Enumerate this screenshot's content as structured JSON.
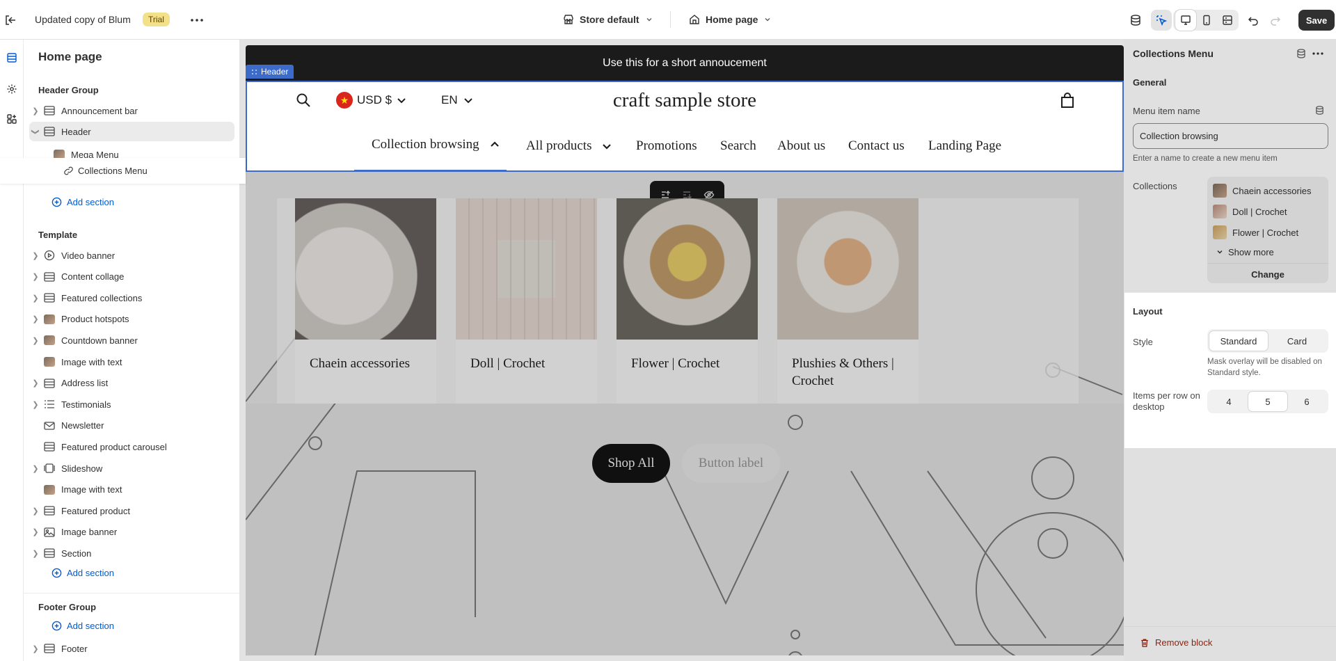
{
  "topbar": {
    "store_name": "Updated copy of Blum",
    "trial_badge": "Trial",
    "theme_select": "Store default",
    "page_select": "Home page",
    "save_label": "Save"
  },
  "left_panel": {
    "title": "Home page",
    "header_group": {
      "label": "Header Group",
      "items": [
        {
          "label": "Announcement bar"
        },
        {
          "label": "Header"
        },
        {
          "label": "Mega Menu"
        },
        {
          "label": "Collections Menu"
        }
      ],
      "add_section": "Add section"
    },
    "template": {
      "label": "Template",
      "items": [
        {
          "label": "Video banner"
        },
        {
          "label": "Content collage"
        },
        {
          "label": "Featured collections"
        },
        {
          "label": "Product hotspots"
        },
        {
          "label": "Countdown banner"
        },
        {
          "label": "Image with text"
        },
        {
          "label": "Address list"
        },
        {
          "label": "Testimonials"
        },
        {
          "label": "Newsletter"
        },
        {
          "label": "Featured product carousel"
        },
        {
          "label": "Slideshow"
        },
        {
          "label": "Image with text"
        },
        {
          "label": "Featured product"
        },
        {
          "label": "Image banner"
        },
        {
          "label": "Section"
        }
      ],
      "add_section": "Add section"
    },
    "footer_group": {
      "label": "Footer Group",
      "add_section": "Add section",
      "items": [
        {
          "label": "Footer"
        }
      ]
    }
  },
  "preview": {
    "announcement": "Use this for a short annoucement",
    "header_tag": "Header",
    "currency": "USD $",
    "language": "EN",
    "store_title": "craft sample store",
    "nav": [
      "Collection browsing",
      "All products",
      "Promotions",
      "Search",
      "About us",
      "Contact us",
      "Landing Page"
    ],
    "collections": [
      {
        "title": "Chaein accessories"
      },
      {
        "title": "Doll | Crochet"
      },
      {
        "title": "Flower | Crochet"
      },
      {
        "title": "Plushies & Others | Crochet"
      }
    ],
    "button_primary": "Shop All",
    "button_secondary": "Button label"
  },
  "right_panel": {
    "title": "Collections Menu",
    "general_heading": "General",
    "menu_item_label": "Menu item name",
    "menu_item_value": "Collection browsing",
    "menu_item_help": "Enter a name to create a new menu item",
    "collections_label": "Collections",
    "collections": [
      "Chaein accessories",
      "Doll | Crochet",
      "Flower | Crochet"
    ],
    "show_more": "Show more",
    "change": "Change",
    "layout_heading": "Layout",
    "style_label": "Style",
    "style_options": [
      "Standard",
      "Card"
    ],
    "style_selected": "Standard",
    "style_help": "Mask overlay will be disabled on Standard style.",
    "items_per_row_label": "Items per row on desktop",
    "items_per_row_options": [
      "4",
      "5",
      "6"
    ],
    "items_per_row_selected": "5",
    "remove_block": "Remove block"
  },
  "colors": {
    "accent": "#005bd3",
    "header_highlight": "#3c6bc9",
    "danger": "#8e1f0b",
    "trial_badge": "#f3e18a"
  }
}
